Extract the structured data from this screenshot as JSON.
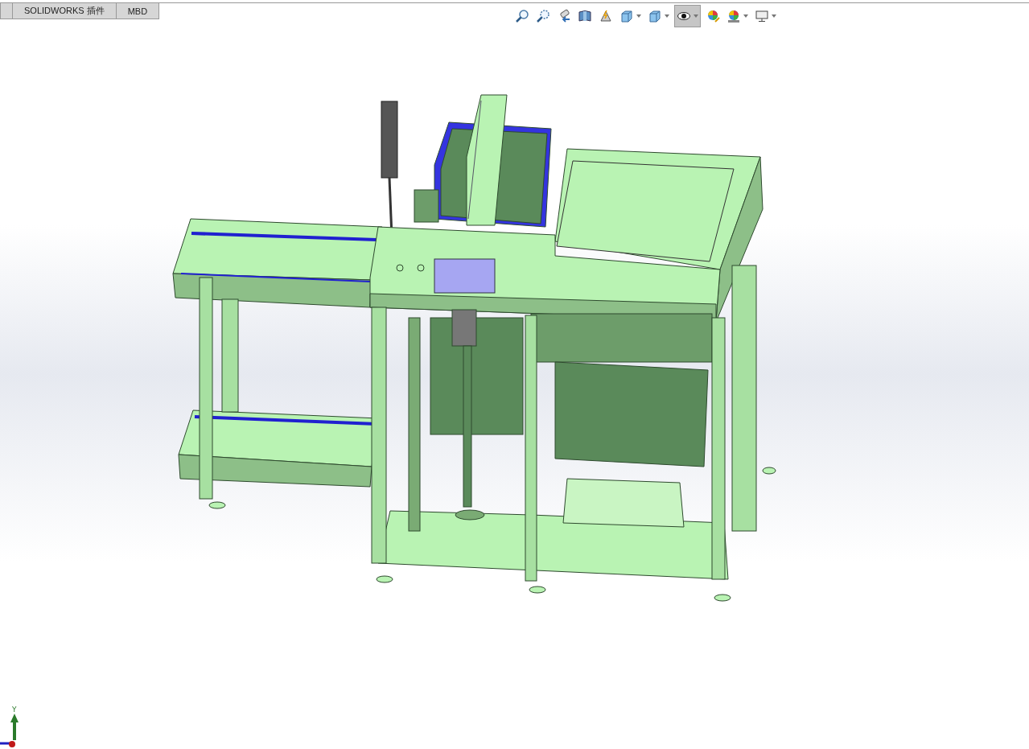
{
  "tabs": [
    {
      "label": "SOLIDWORKS 插件"
    },
    {
      "label": "MBD"
    }
  ],
  "view_toolbar": [
    {
      "kind": "zoom-fit",
      "dropdown": false,
      "pressed": false
    },
    {
      "kind": "zoom-area",
      "dropdown": false,
      "pressed": false
    },
    {
      "kind": "previous-view",
      "dropdown": false,
      "pressed": false
    },
    {
      "kind": "section-view",
      "dropdown": false,
      "pressed": false
    },
    {
      "kind": "dynamic-annotation",
      "dropdown": false,
      "pressed": false
    },
    {
      "kind": "view-orientation",
      "dropdown": true,
      "pressed": false
    },
    {
      "kind": "display-style",
      "dropdown": true,
      "pressed": false
    },
    {
      "kind": "hide-show",
      "dropdown": true,
      "pressed": true
    },
    {
      "kind": "edit-appearance",
      "dropdown": false,
      "pressed": false
    },
    {
      "kind": "apply-scene",
      "dropdown": true,
      "pressed": false
    },
    {
      "kind": "view-settings",
      "dropdown": true,
      "pressed": false
    }
  ],
  "triad": {
    "axis_label": "Y"
  }
}
